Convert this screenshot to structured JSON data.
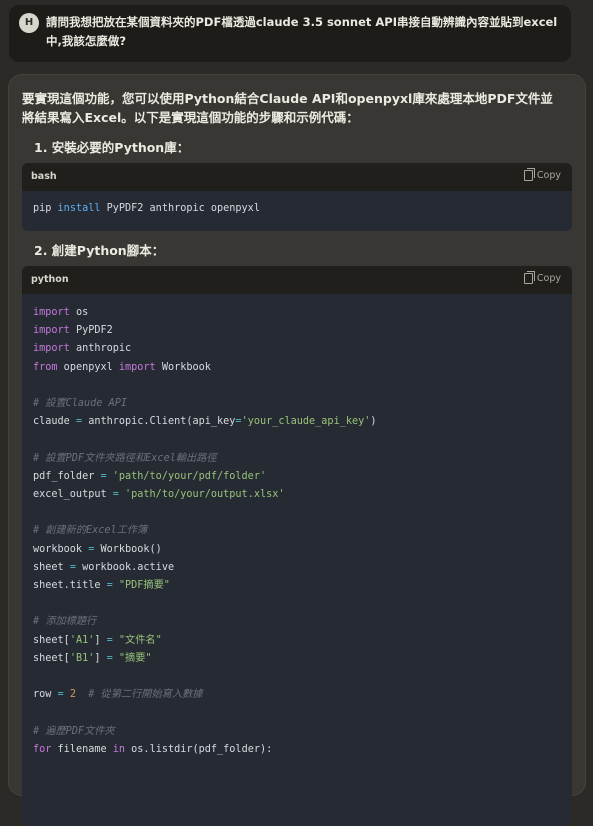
{
  "user": {
    "avatar": "H",
    "message": "請問我想把放在某個資料夾的PDF檔透過claude 3.5 sonnet API串接自動辨識內容並貼到excel中,我該怎麼做?"
  },
  "assistant": {
    "intro": "要實現這個功能，您可以使用Python結合Claude API和openpyxl庫來處理本地PDF文件並將結果寫入Excel。以下是實現這個功能的步驟和示例代碼：",
    "step1": "1. 安裝必要的Python庫：",
    "step2": "2. 創建Python腳本："
  },
  "bash_block": {
    "lang": "bash",
    "copy_label": "Copy",
    "code": "pip install PyPDF2 anthropic openpyxl"
  },
  "python_block": {
    "lang": "python",
    "copy_label": "Copy",
    "lines": [
      "import os",
      "import PyPDF2",
      "import anthropic",
      "from openpyxl import Workbook",
      "",
      "# 設置Claude API",
      "claude = anthropic.Client(api_key='your_claude_api_key')",
      "",
      "# 設置PDF文件夾路徑和Excel輸出路徑",
      "pdf_folder = 'path/to/your/pdf/folder'",
      "excel_output = 'path/to/your/output.xlsx'",
      "",
      "# 創建新的Excel工作簿",
      "workbook = Workbook()",
      "sheet = workbook.active",
      "sheet.title = \"PDF摘要\"",
      "",
      "# 添加標題行",
      "sheet['A1'] = \"文件名\"",
      "sheet['B1'] = \"摘要\"",
      "",
      "row = 2  # 從第二行開始寫入數據",
      "",
      "# 遍歷PDF文件夾",
      "for filename in os.listdir(pdf_folder):"
    ]
  }
}
